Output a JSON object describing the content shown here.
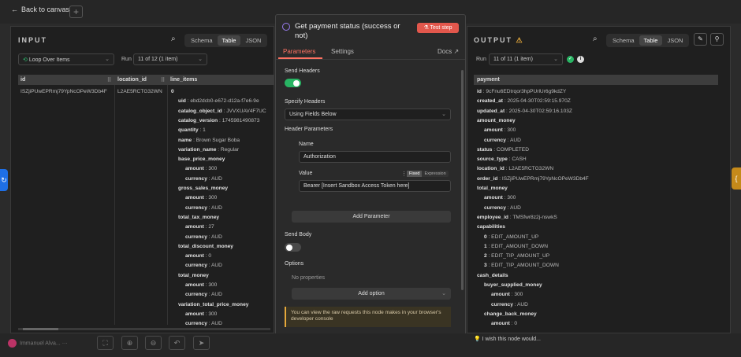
{
  "topbar": {
    "back_label": "Back to canvas"
  },
  "input": {
    "title": "INPUT",
    "views": [
      "Schema",
      "Table",
      "JSON"
    ],
    "node_select": "Loop Over Items",
    "run_label": "Run",
    "run_value": "11 of 12 (1 item)",
    "columns": [
      "id",
      "location_id",
      "line_items"
    ],
    "row": {
      "id": "ISZjiPUwEPRmj79YpNcOPeW3Db4F",
      "location_id": "L2AE5RCTG32WN"
    },
    "tree": [
      {
        "text": "0",
        "bold": true,
        "indent": 0
      },
      {
        "key": "uid",
        "val": "ebd2dcb0-e672-d12a-f7e6-9e",
        "indent": 1
      },
      {
        "key": "catalog_object_id",
        "val": "JVVXUAV4F7UC",
        "indent": 1
      },
      {
        "key": "catalog_version",
        "val": "1745981490873",
        "indent": 1
      },
      {
        "key": "quantity",
        "val": "1",
        "indent": 1
      },
      {
        "key": "name",
        "val": "Brown Sugar Boba",
        "indent": 1
      },
      {
        "key": "variation_name",
        "val": "Regular",
        "indent": 1
      },
      {
        "key": "base_price_money",
        "val": "",
        "indent": 1
      },
      {
        "key": "amount",
        "val": "300",
        "indent": 2
      },
      {
        "key": "currency",
        "val": "AUD",
        "indent": 2
      },
      {
        "key": "gross_sales_money",
        "val": "",
        "indent": 1
      },
      {
        "key": "amount",
        "val": "300",
        "indent": 2
      },
      {
        "key": "currency",
        "val": "AUD",
        "indent": 2
      },
      {
        "key": "total_tax_money",
        "val": "",
        "indent": 1
      },
      {
        "key": "amount",
        "val": "27",
        "indent": 2
      },
      {
        "key": "currency",
        "val": "AUD",
        "indent": 2
      },
      {
        "key": "total_discount_money",
        "val": "",
        "indent": 1
      },
      {
        "key": "amount",
        "val": "0",
        "indent": 2
      },
      {
        "key": "currency",
        "val": "AUD",
        "indent": 2
      },
      {
        "key": "total_money",
        "val": "",
        "indent": 1
      },
      {
        "key": "amount",
        "val": "300",
        "indent": 2
      },
      {
        "key": "currency",
        "val": "AUD",
        "indent": 2
      },
      {
        "key": "variation_total_price_money",
        "val": "",
        "indent": 1
      },
      {
        "key": "amount",
        "val": "300",
        "indent": 2
      },
      {
        "key": "currency",
        "val": "AUD",
        "indent": 2
      }
    ]
  },
  "node": {
    "title": "Get payment status (success or not)",
    "test_label": "Test step",
    "tabs": [
      "Parameters",
      "Settings"
    ],
    "docs_label": "Docs",
    "send_headers_label": "Send Headers",
    "specify_headers_label": "Specify Headers",
    "specify_headers_value": "Using Fields Below",
    "header_params_label": "Header Parameters",
    "name_label": "Name",
    "name_value": "Authorization",
    "value_label": "Value",
    "fixed_label": "Fixed",
    "expression_label": "Expression",
    "value_value": "Bearer [Insert Sandbox Access Token here]",
    "add_param_label": "Add Parameter",
    "send_body_label": "Send Body",
    "options_label": "Options",
    "no_props_label": "No properties",
    "add_option_label": "Add option",
    "note": "You can view the raw requests this node makes in your browser's developer console"
  },
  "output": {
    "title": "OUTPUT",
    "views": [
      "Schema",
      "Table",
      "JSON"
    ],
    "run_label": "Run",
    "run_value": "11 of 11 (1 item)",
    "column": "payment",
    "tree": [
      {
        "key": "id",
        "val": "9cFnu6EDtrqor3hpPUrlUr6g9kdZY",
        "indent": 0
      },
      {
        "key": "created_at",
        "val": "2025-04-30T02:59:15.970Z",
        "indent": 0
      },
      {
        "key": "updated_at",
        "val": "2025-04-30T02:59:16.103Z",
        "indent": 0
      },
      {
        "key": "amount_money",
        "val": "",
        "indent": 0
      },
      {
        "key": "amount",
        "val": "300",
        "indent": 1
      },
      {
        "key": "currency",
        "val": "AUD",
        "indent": 1
      },
      {
        "key": "status",
        "val": "COMPLETED",
        "indent": 0
      },
      {
        "key": "source_type",
        "val": "CASH",
        "indent": 0
      },
      {
        "key": "location_id",
        "val": "L2AE5RCTG32WN",
        "indent": 0
      },
      {
        "key": "order_id",
        "val": "ISZjiPUwEPRmj79YpNcOPeW3Db4F",
        "indent": 0
      },
      {
        "key": "total_money",
        "val": "",
        "indent": 0
      },
      {
        "key": "amount",
        "val": "300",
        "indent": 1
      },
      {
        "key": "currency",
        "val": "AUD",
        "indent": 1
      },
      {
        "key": "employee_id",
        "val": "TMSfwr8z2j-nswkS",
        "indent": 0
      },
      {
        "key": "capabilities",
        "val": "",
        "indent": 0
      },
      {
        "key": "0",
        "val": "EDIT_AMOUNT_UP",
        "indent": 1
      },
      {
        "key": "1",
        "val": "EDIT_AMOUNT_DOWN",
        "indent": 1
      },
      {
        "key": "2",
        "val": "EDIT_TIP_AMOUNT_UP",
        "indent": 1
      },
      {
        "key": "3",
        "val": "EDIT_TIP_AMOUNT_DOWN",
        "indent": 1
      },
      {
        "key": "cash_details",
        "val": "",
        "indent": 0
      },
      {
        "key": "buyer_supplied_money",
        "val": "",
        "indent": 1
      },
      {
        "key": "amount",
        "val": "300",
        "indent": 2
      },
      {
        "key": "currency",
        "val": "AUD",
        "indent": 2
      },
      {
        "key": "change_back_money",
        "val": "",
        "indent": 1
      },
      {
        "key": "amount",
        "val": "0",
        "indent": 2
      }
    ]
  },
  "bottombar": {
    "user": "Immanuel Alva...",
    "wish": "I wish this node would..."
  },
  "colors": {
    "accent": "#ff7262",
    "toggle_on": "#28b463",
    "test_btn": "#e2574c",
    "note_border": "#e5a83b"
  }
}
